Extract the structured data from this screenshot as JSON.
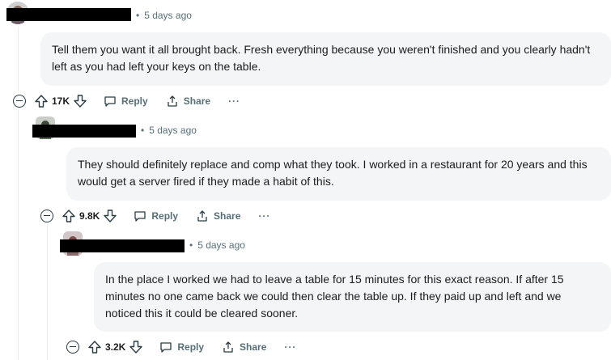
{
  "comments": [
    {
      "time": "5 days ago",
      "body": "Tell them you want it all brought back. Fresh everything because you weren't finished and you clearly hadn't left as you had left your keys on the table.",
      "votes": "17K",
      "reply_label": "Reply",
      "share_label": "Share",
      "more_label": "···"
    },
    {
      "time": "5 days ago",
      "body": "They should definitely replace and comp what they took. I worked in a restaurant for 20 years and this would get a server fired if they made a habit of this.",
      "votes": "9.8K",
      "reply_label": "Reply",
      "share_label": "Share",
      "more_label": "···"
    },
    {
      "time": "5 days ago",
      "body": "In the place I worked we had to leave a table for 15 minutes for this exact reason. If after 15 minutes no one came back we could then clear the table up. If they paid up and left and we noticed this it could be cleared sooner.",
      "votes": "3.2K",
      "reply_label": "Reply",
      "share_label": "Share",
      "more_label": "···"
    }
  ],
  "colors": {
    "meta_text": "#576f76",
    "bubble_bg": "#f3f5f6",
    "thread_line": "#e5ebee",
    "redaction": "#000000"
  },
  "icons": [
    "upvote-icon",
    "downvote-icon",
    "reply-bubble-icon",
    "share-icon",
    "collapse-icon",
    "more-icon"
  ]
}
